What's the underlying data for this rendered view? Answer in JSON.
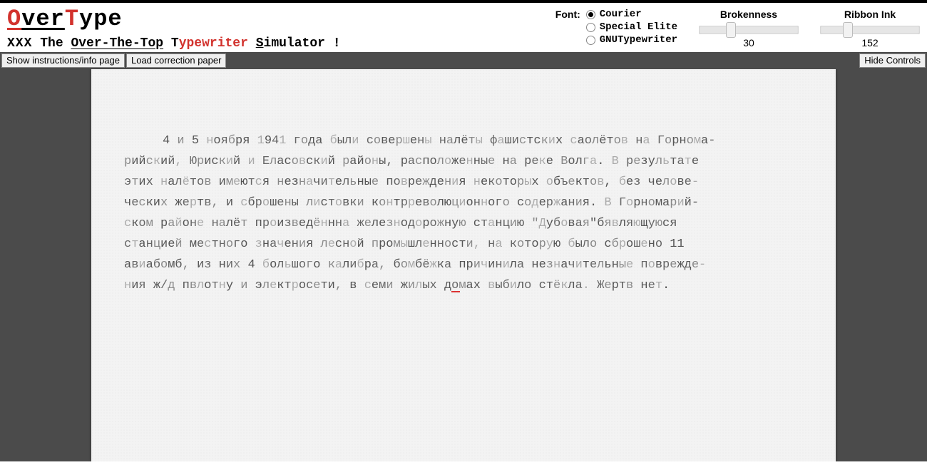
{
  "brand": {
    "title_html": "OverType"
  },
  "tagline": {
    "strike": "XXX",
    "the": "The",
    "over_the_top": "Over-The-Top",
    "typewriter": "Typewriter",
    "simulator": "Simulator",
    "bang": "!"
  },
  "controls": {
    "font": {
      "label": "Font:",
      "options": [
        "Courier",
        "Special Elite",
        "GNUTypewriter"
      ],
      "selected": 0
    },
    "brokenness": {
      "label": "Brokenness",
      "value": 30,
      "min": 0,
      "max": 100
    },
    "ribbon": {
      "label": "Ribbon Ink",
      "value": 152,
      "min": 0,
      "max": 600
    }
  },
  "toolbar": {
    "show_instructions": "Show instructions/info page",
    "load_correction": "Load correction paper",
    "hide_controls": "Hide Controls"
  },
  "document": {
    "lines": [
      "4 и 5 ноября 1941 года были совершены налёты фашистских саолётов на Горнома-",
      "рийский, Юриский и Еласовский районы, расположенные на реке Волга. В результате",
      "этих налётов имеются незначительные повреждения некоторых объектов, без челове-",
      "ческих жертв, и сброшены листовки контрреволюционного содержания. В Горномарий-",
      "ском районе налёт произведённна железнодорожную станцию \"Дубовая\"бявляющуюся",
      "станцией местного значения лесной промышленности, на которую было сброшено 11",
      "авиабомб, из них 4 большого калибра, бомбёжка причинила незначительные поврежде-",
      "ния ж/д пвлотну и электросети, в семи жилых домах выбило стёкла. Жертв нет."
    ],
    "caret_line": 7,
    "caret_col": 45
  }
}
